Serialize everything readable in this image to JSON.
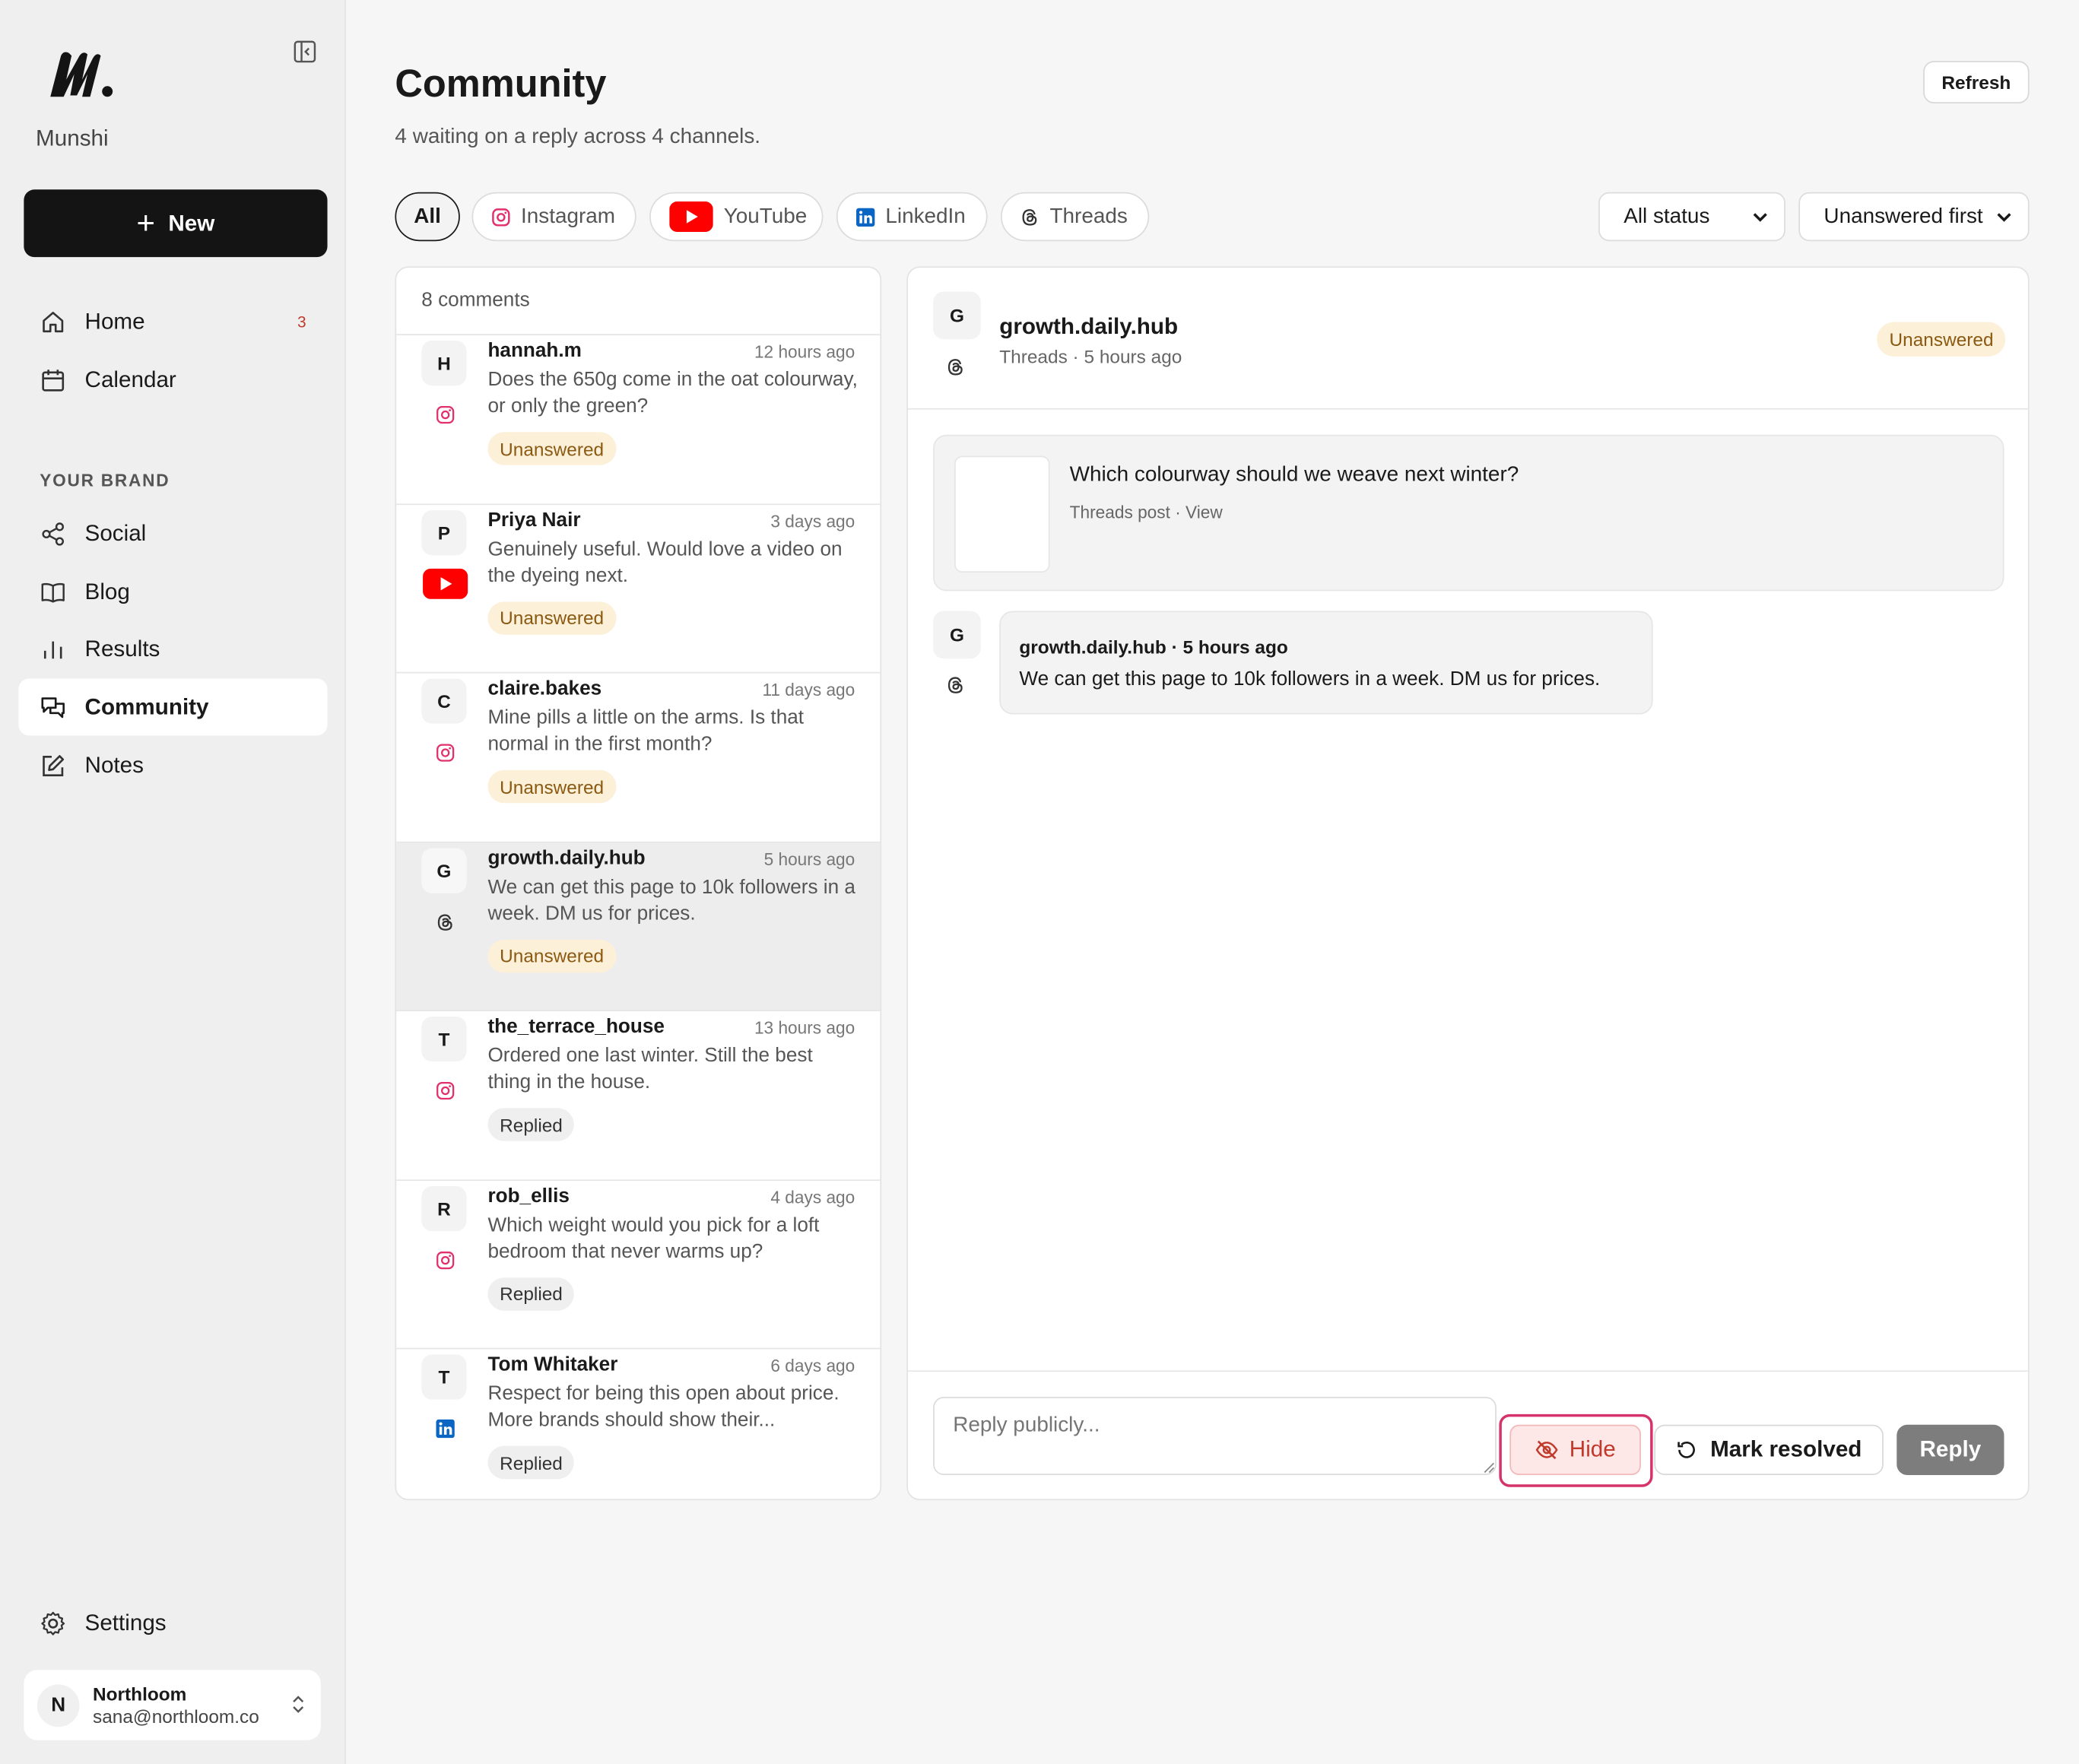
{
  "app": {
    "brand": "Munshi",
    "new_label": "New"
  },
  "nav": [
    {
      "id": "home",
      "label": "Home",
      "badge": "3"
    },
    {
      "id": "calendar",
      "label": "Calendar"
    }
  ],
  "brand_section": {
    "label": "YOUR BRAND",
    "items": [
      {
        "id": "social",
        "label": "Social"
      },
      {
        "id": "blog",
        "label": "Blog"
      },
      {
        "id": "results",
        "label": "Results"
      },
      {
        "id": "community",
        "label": "Community",
        "active": true
      },
      {
        "id": "notes",
        "label": "Notes"
      }
    ]
  },
  "settings_label": "Settings",
  "account": {
    "initial": "N",
    "name": "Northloom",
    "email": "sana@northloom.co"
  },
  "header": {
    "title": "Community",
    "subtitle": "4 waiting on a reply across 4 channels.",
    "refresh_label": "Refresh"
  },
  "tabs": [
    {
      "label": "All",
      "active": true
    },
    {
      "label": "Instagram",
      "icon": "instagram-icon"
    },
    {
      "label": "YouTube",
      "icon": "youtube-icon"
    },
    {
      "label": "LinkedIn",
      "icon": "linkedin-icon"
    },
    {
      "label": "Threads",
      "icon": "threads-icon"
    }
  ],
  "filters": {
    "status": "All status",
    "sort": "Unanswered first"
  },
  "list": {
    "count_label": "8 comments",
    "items": [
      {
        "initial": "H",
        "name": "hannah.m",
        "time": "12 hours ago",
        "network": "instagram",
        "text": "Does the 650g come in the oat colourway, or only the green?",
        "status": "Unanswered"
      },
      {
        "initial": "P",
        "name": "Priya Nair",
        "time": "3 days ago",
        "network": "youtube",
        "text": "Genuinely useful. Would love a video on the dyeing next.",
        "status": "Unanswered"
      },
      {
        "initial": "C",
        "name": "claire.bakes",
        "time": "11 days ago",
        "network": "instagram",
        "text": "Mine pills a little on the arms. Is that normal in the first month?",
        "status": "Unanswered"
      },
      {
        "initial": "G",
        "name": "growth.daily.hub",
        "time": "5 hours ago",
        "network": "threads",
        "text": "We can get this page to 10k followers in a week. DM us for prices.",
        "status": "Unanswered",
        "selected": true
      },
      {
        "initial": "T",
        "name": "the_terrace_house",
        "time": "13 hours ago",
        "network": "instagram",
        "text": "Ordered one last winter. Still the best thing in the house.",
        "status": "Replied"
      },
      {
        "initial": "R",
        "name": "rob_ellis",
        "time": "4 days ago",
        "network": "instagram",
        "text": "Which weight would you pick for a loft bedroom that never warms up?",
        "status": "Replied"
      },
      {
        "initial": "T",
        "name": "Tom Whitaker",
        "time": "6 days ago",
        "network": "linkedin",
        "text": "Respect for being this open about price. More brands should show their...",
        "status": "Replied"
      }
    ]
  },
  "detail": {
    "initial": "G",
    "name": "growth.daily.hub",
    "meta": "Threads · 5 hours ago",
    "status": "Unanswered",
    "post_title": "Which colourway should we weave next winter?",
    "post_meta": "Threads post · View",
    "message_head": "growth.daily.hub · 5 hours ago",
    "message_text": "We can get this page to 10k followers in a week. DM us for prices.",
    "reply_placeholder": "Reply publicly...",
    "hide_label": "Hide",
    "resolve_label": "Mark resolved",
    "reply_label": "Reply"
  },
  "colors": {
    "instagram": "#e1306c",
    "youtube": "#ff0000",
    "linkedin": "#0a66c2",
    "unanswered_bg": "#fdf0d9",
    "hide_outline": "#d6336c"
  }
}
